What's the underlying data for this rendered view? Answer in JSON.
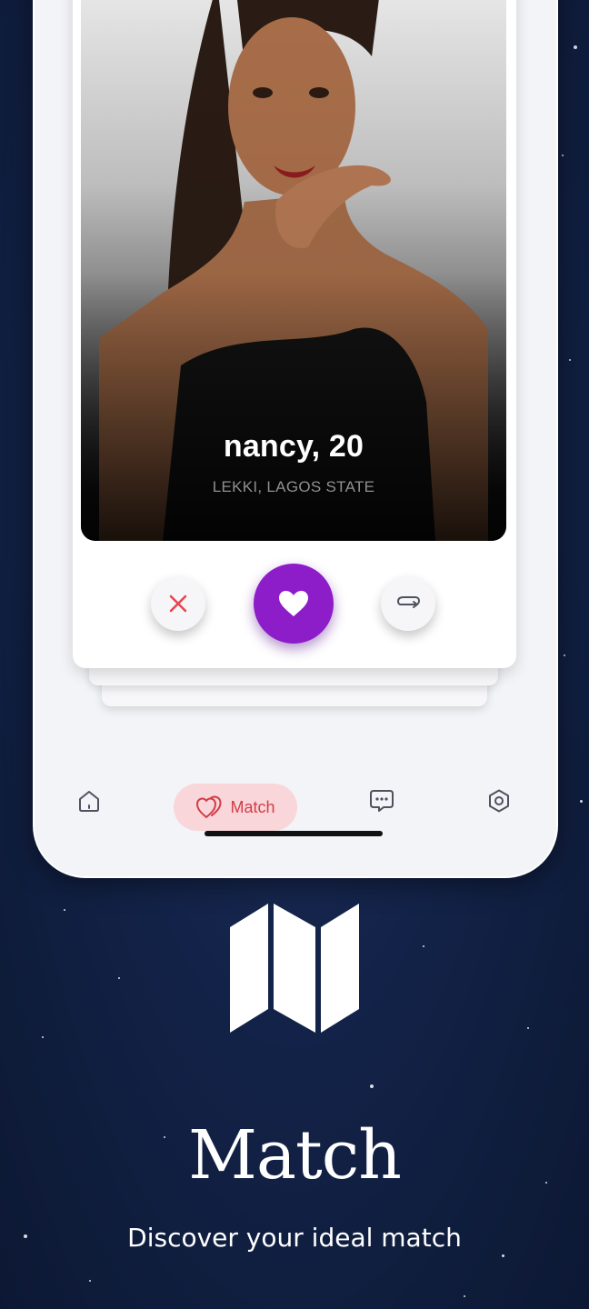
{
  "profile": {
    "name_age": "nancy, 20",
    "location": "LEKKI, LAGOS STATE"
  },
  "actions": {
    "dislike_icon": "close-icon",
    "like_icon": "heart-icon",
    "rewind_icon": "rewind-icon"
  },
  "nav": {
    "items": [
      {
        "icon": "home-icon"
      },
      {
        "icon": "double-heart-icon",
        "label": "Match"
      },
      {
        "icon": "chat-icon"
      },
      {
        "icon": "settings-icon"
      }
    ]
  },
  "feature": {
    "icon": "map-icon",
    "title": "Match",
    "subtitle": "Discover your ideal match"
  },
  "colors": {
    "background": "#132349",
    "accent_purple": "#8d1cc9",
    "accent_red": "#d43c47",
    "pill_background": "#f9d6d9"
  }
}
